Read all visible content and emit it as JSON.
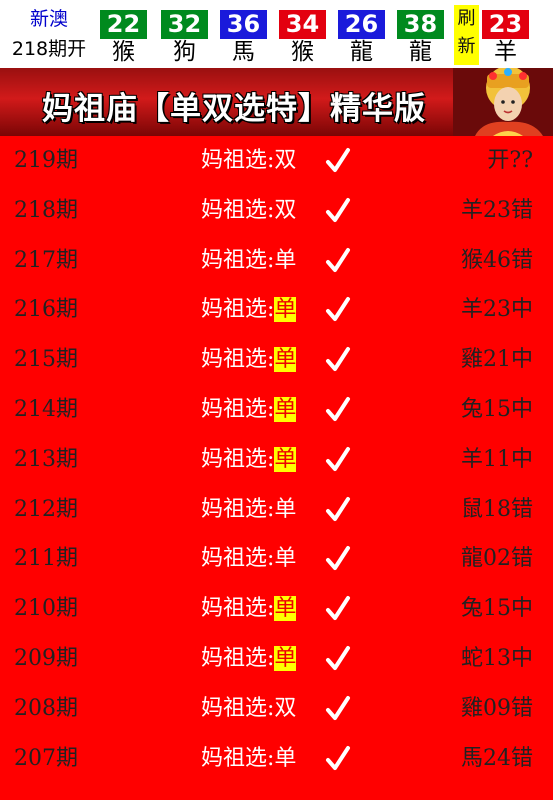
{
  "header": {
    "region": "新澳",
    "issue": "218期开",
    "balls": [
      {
        "number": "22",
        "zodiac": "猴",
        "color": "green"
      },
      {
        "number": "32",
        "zodiac": "狗",
        "color": "green"
      },
      {
        "number": "36",
        "zodiac": "馬",
        "color": "blue"
      },
      {
        "number": "34",
        "zodiac": "猴",
        "color": "red"
      },
      {
        "number": "26",
        "zodiac": "龍",
        "color": "blue"
      },
      {
        "number": "38",
        "zodiac": "龍",
        "color": "green"
      },
      {
        "number": "23",
        "zodiac": "羊",
        "color": "red"
      }
    ],
    "refresh": [
      "刷",
      "新"
    ]
  },
  "banner": {
    "title": "妈祖庙【单双选特】精华版"
  },
  "pick_label": "妈祖选:",
  "rows": [
    {
      "period": "219期",
      "pick": "双",
      "highlight": false,
      "result": "开??"
    },
    {
      "period": "218期",
      "pick": "双",
      "highlight": false,
      "result": "羊23错"
    },
    {
      "period": "217期",
      "pick": "单",
      "highlight": false,
      "result": "猴46错"
    },
    {
      "period": "216期",
      "pick": "单",
      "highlight": true,
      "result": "羊23中"
    },
    {
      "period": "215期",
      "pick": "单",
      "highlight": true,
      "result": "雞21中"
    },
    {
      "period": "214期",
      "pick": "单",
      "highlight": true,
      "result": "兔15中"
    },
    {
      "period": "213期",
      "pick": "单",
      "highlight": true,
      "result": "羊11中"
    },
    {
      "period": "212期",
      "pick": "单",
      "highlight": false,
      "result": "鼠18错"
    },
    {
      "period": "211期",
      "pick": "单",
      "highlight": false,
      "result": "龍02错"
    },
    {
      "period": "210期",
      "pick": "单",
      "highlight": true,
      "result": "兔15中"
    },
    {
      "period": "209期",
      "pick": "单",
      "highlight": true,
      "result": "蛇13中"
    },
    {
      "period": "208期",
      "pick": "双",
      "highlight": false,
      "result": "雞09错"
    },
    {
      "period": "207期",
      "pick": "单",
      "highlight": false,
      "result": "馬24错"
    }
  ]
}
